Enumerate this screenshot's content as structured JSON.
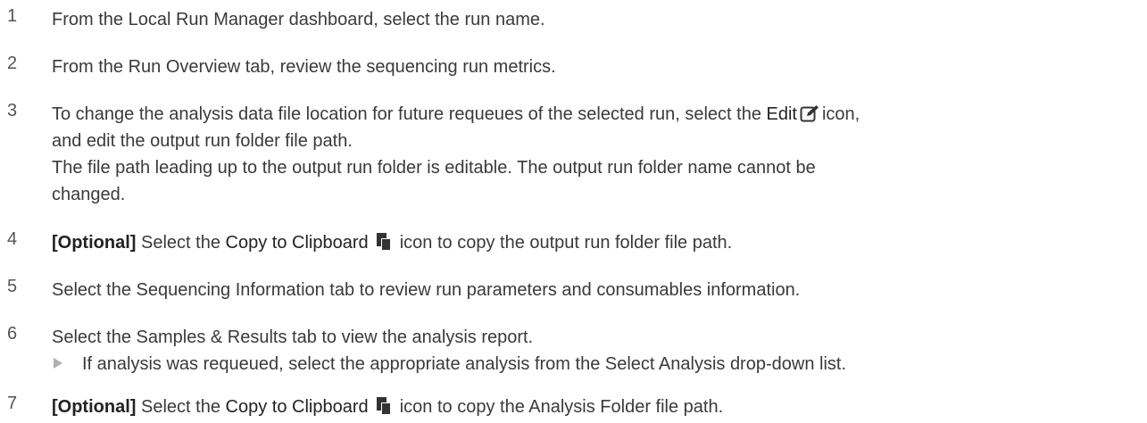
{
  "steps": [
    {
      "num": "1",
      "text": "From the Local Run Manager dashboard, select the run name."
    },
    {
      "num": "2",
      "text": "From the Run Overview tab, review the sequencing run metrics."
    },
    {
      "num": "3",
      "pre": "To change the analysis data file location for future requeues of the selected run, select the",
      "ui": "Edit",
      "post": "icon,",
      "line2": "and edit the output run folder file path.",
      "note1": "The file path leading up to the output run folder is editable. The output run folder name cannot be",
      "note2": "changed."
    },
    {
      "num": "4",
      "opt": "[Optional]",
      "pre": "Select the",
      "ui": "Copy to Clipboard",
      "post": "icon to copy the output run folder file path."
    },
    {
      "num": "5",
      "text": "Select the Sequencing Information tab to review run parameters and consumables information."
    },
    {
      "num": "6",
      "text": "Select the Samples & Results tab to view the analysis report.",
      "sub": "If analysis was requeued, select the appropriate analysis from the Select Analysis drop-down list."
    },
    {
      "num": "7",
      "opt": "[Optional]",
      "pre": "Select the",
      "ui": "Copy to Clipboard",
      "post": "icon to copy the Analysis Folder file path."
    }
  ],
  "icons": {
    "edit": "edit-icon",
    "clipboard": "clipboard-icon"
  }
}
